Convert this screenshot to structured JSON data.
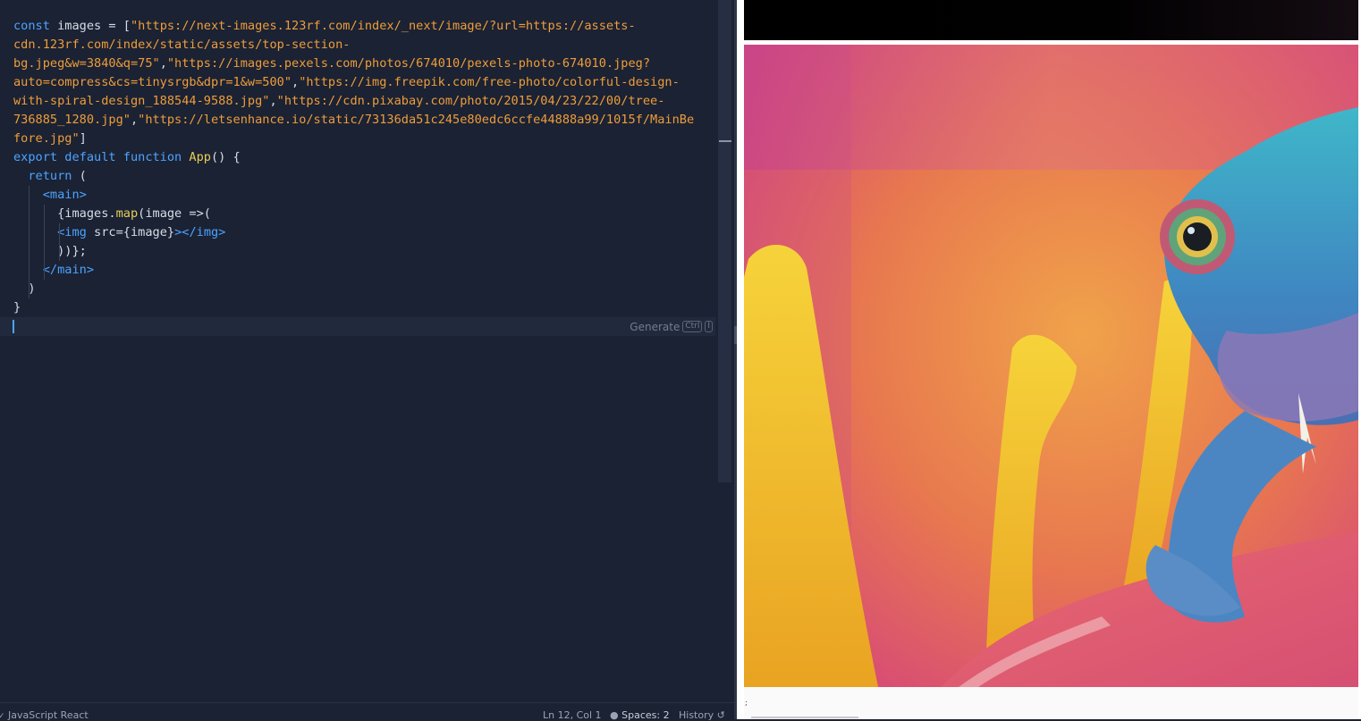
{
  "editor": {
    "code_lines": [
      [
        [
          "kw",
          "const "
        ],
        [
          "txt",
          "images = ["
        ],
        [
          "str",
          "\"https://next-images.123rf.com/index/_next/image/?url=https://assets-"
        ]
      ],
      [
        [
          "str",
          "cdn.123rf.com/index/static/assets/top-section-"
        ]
      ],
      [
        [
          "str",
          "bg.jpeg&w=3840&q=75\""
        ],
        [
          "txt",
          ","
        ],
        [
          "str",
          "\"https://images.pexels.com/photos/674010/pexels-photo-674010.jpeg?"
        ]
      ],
      [
        [
          "str",
          "auto=compress&cs=tinysrgb&dpr=1&w=500\""
        ],
        [
          "txt",
          ","
        ],
        [
          "str",
          "\"https://img.freepik.com/free-photo/colorful-design-"
        ]
      ],
      [
        [
          "str",
          "with-spiral-design_188544-9588.jpg\""
        ],
        [
          "txt",
          ","
        ],
        [
          "str",
          "\"https://cdn.pixabay.com/photo/2015/04/23/22/00/tree-"
        ]
      ],
      [
        [
          "str",
          "736885_1280.jpg\""
        ],
        [
          "txt",
          ","
        ],
        [
          "str",
          "\"https://letsenhance.io/static/73136da51c245e80edc6ccfe44888a99/1015f/MainBe"
        ]
      ],
      [
        [
          "str",
          "fore.jpg\""
        ],
        [
          "txt",
          "]"
        ]
      ],
      [
        [
          "kw",
          "export default function "
        ],
        [
          "fn",
          "App"
        ],
        [
          "txt",
          "() {"
        ]
      ],
      [
        [
          "txt",
          "  "
        ],
        [
          "kw",
          "return"
        ],
        [
          "txt",
          " ("
        ]
      ],
      [
        [
          "txt",
          "    "
        ],
        [
          "tag",
          "<main"
        ],
        [
          "tag",
          ">"
        ]
      ],
      [
        [
          "txt",
          "      {images."
        ],
        [
          "fn",
          "map"
        ],
        [
          "txt",
          "(image =>("
        ]
      ],
      [
        [
          "txt",
          "      "
        ],
        [
          "tag",
          "<img"
        ],
        [
          "txt",
          " src={image}"
        ],
        [
          "tag",
          "></img>"
        ]
      ],
      [
        [
          "txt",
          "      ))};"
        ]
      ],
      [
        [
          "txt",
          "    "
        ],
        [
          "tag",
          "</main>"
        ]
      ],
      [
        [
          "txt",
          "  )"
        ]
      ],
      [
        [
          "txt",
          "}"
        ]
      ],
      [
        [
          "txt",
          ""
        ]
      ]
    ],
    "generate_hint": "Generate",
    "generate_key1": "Ctrl",
    "generate_key2": "I"
  },
  "status_bar": {
    "language": "JavaScript React",
    "position": "Ln 12, Col 1",
    "spaces": "Spaces: 2",
    "history": "History"
  },
  "preview": {
    "image_subject": "chameleon-on-flower-photo"
  }
}
